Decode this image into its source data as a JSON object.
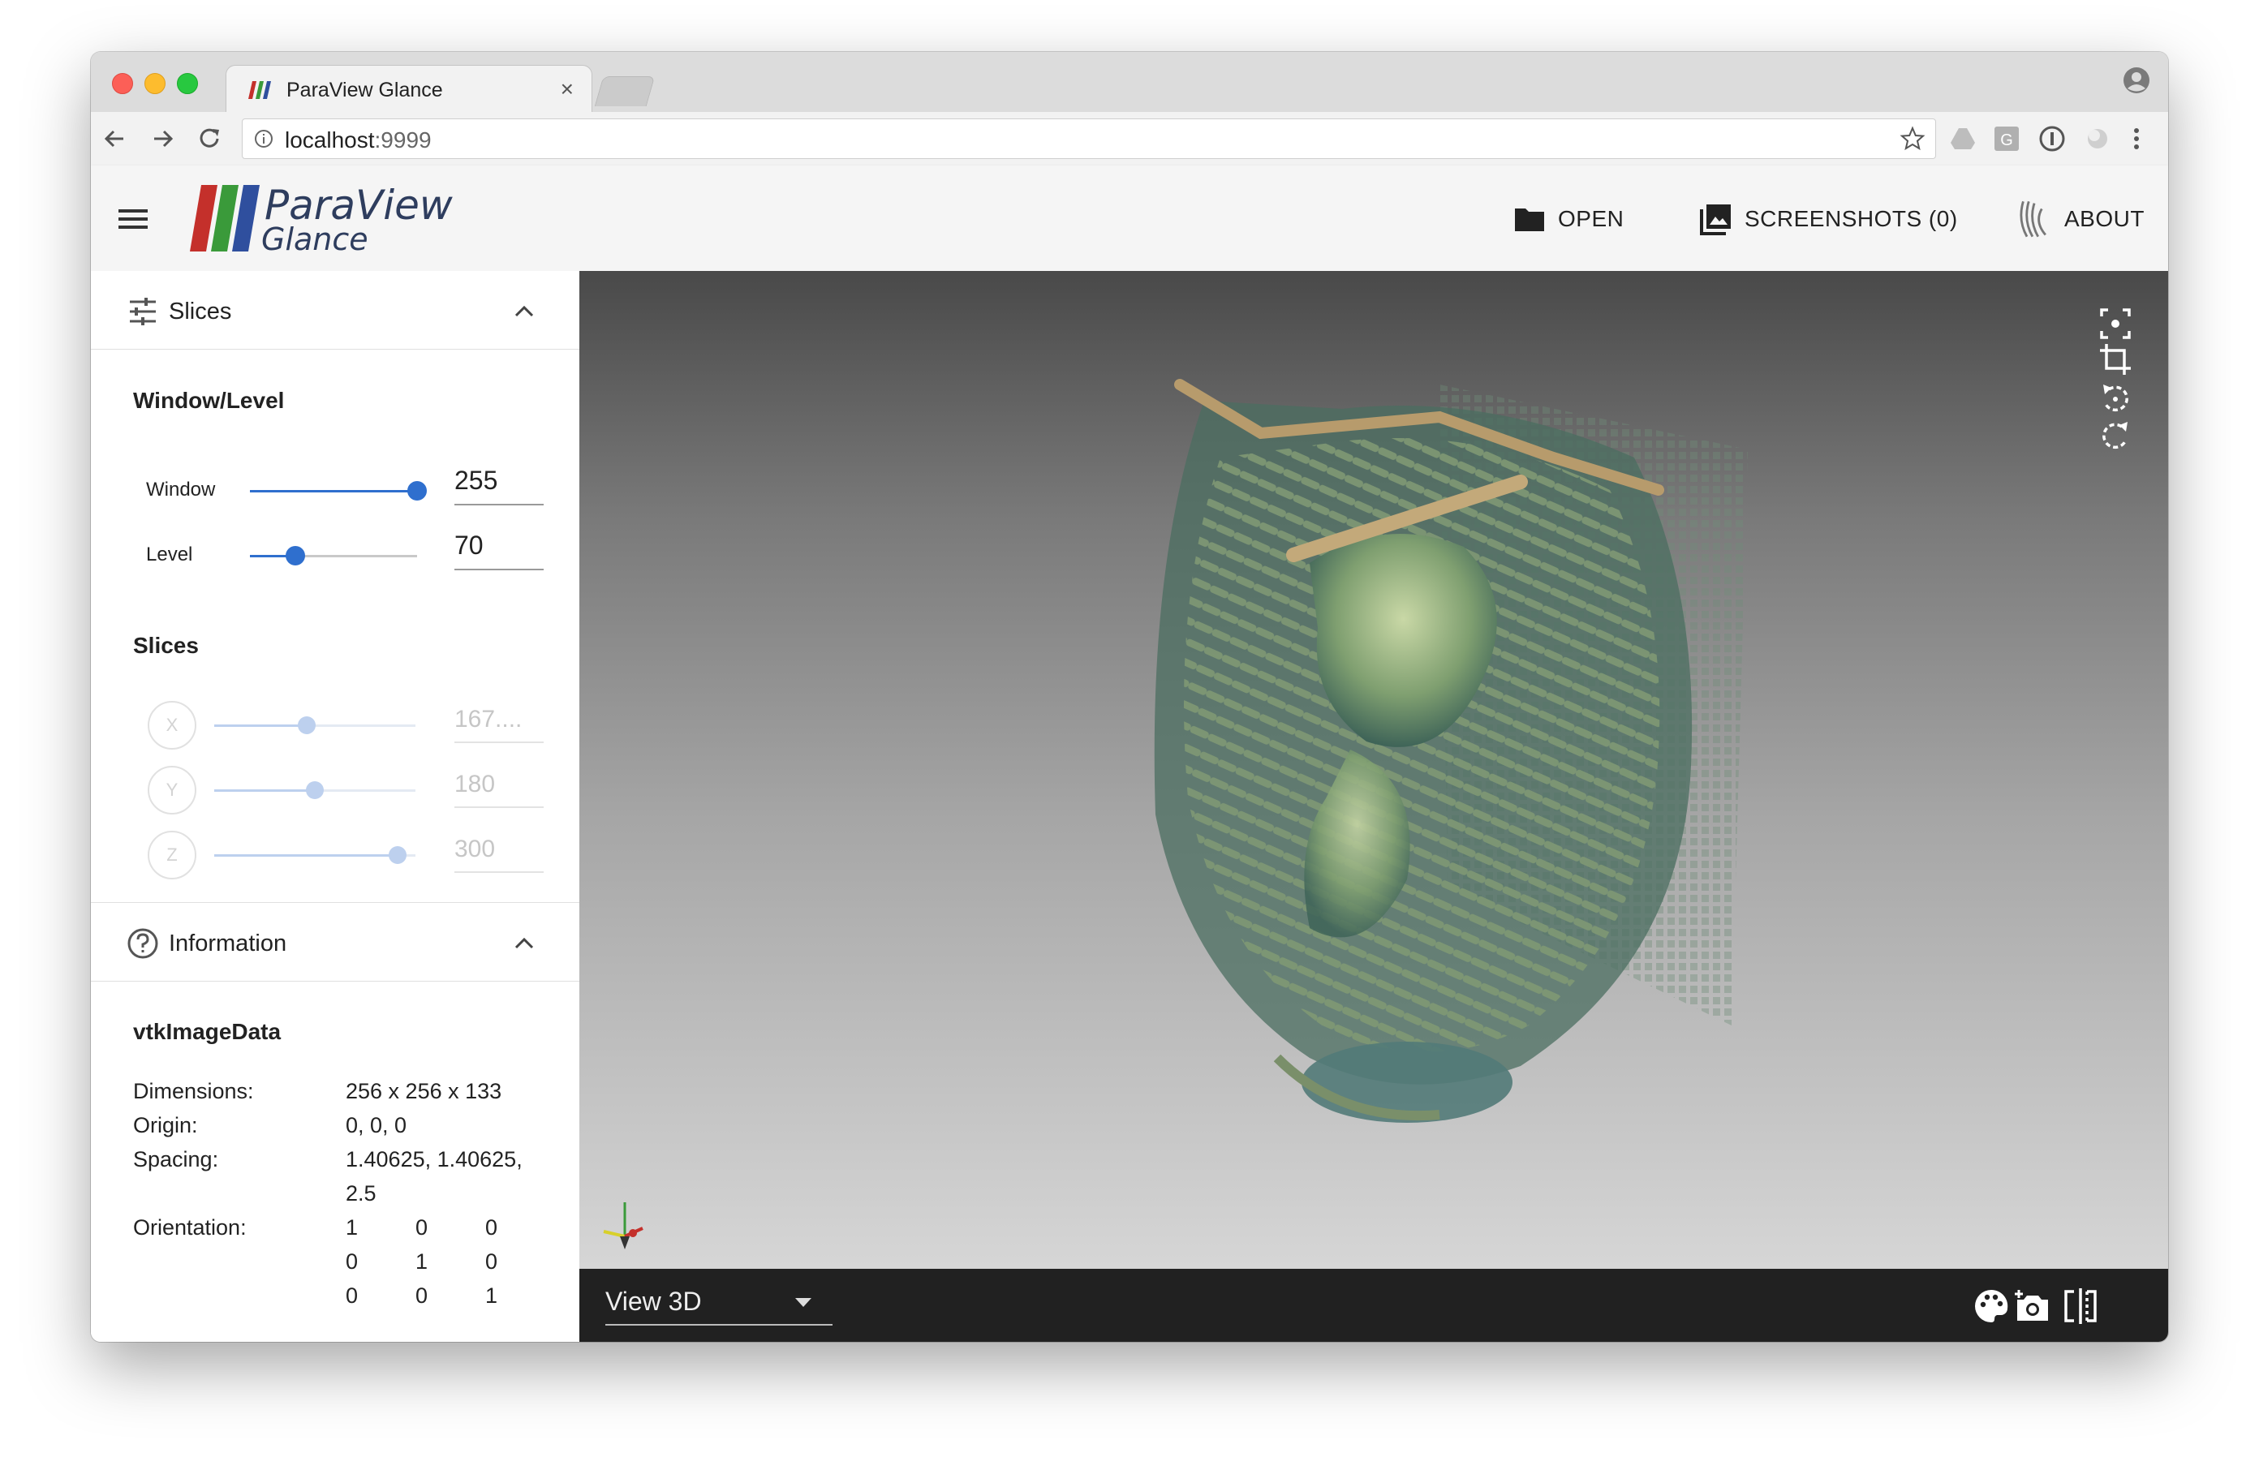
{
  "browser": {
    "tab_title": "ParaView Glance",
    "tab_close": "×",
    "url_host": "localhost",
    "url_port": ":9999"
  },
  "appbar": {
    "logo_top": "ParaView",
    "logo_bottom": "Glance",
    "open_label": "OPEN",
    "screenshots_label": "SCREENSHOTS (0)",
    "about_label": "ABOUT"
  },
  "slices_panel": {
    "title": "Slices",
    "window_level": {
      "heading": "Window/Level",
      "window_label": "Window",
      "window_value": "255",
      "window_fraction": 1.0,
      "level_label": "Level",
      "level_value": "70",
      "level_fraction": 0.27
    },
    "slices": {
      "heading": "Slices",
      "items": [
        {
          "axis": "X",
          "value": "167....",
          "fraction": 0.46
        },
        {
          "axis": "Y",
          "value": "180",
          "fraction": 0.5
        },
        {
          "axis": "Z",
          "value": "300",
          "fraction": 0.91
        }
      ]
    }
  },
  "information_panel": {
    "title": "Information",
    "data_type": "vtkImageData",
    "dimensions_label": "Dimensions:",
    "dimensions_value": "256 x 256 x 133",
    "origin_label": "Origin:",
    "origin_value": "0, 0, 0",
    "spacing_label": "Spacing:",
    "spacing_value_line1": "1.40625, 1.40625,",
    "spacing_value_line2": "2.5",
    "orientation_label": "Orientation:",
    "orientation_rows": [
      [
        "1",
        "0",
        "0"
      ],
      [
        "0",
        "1",
        "0"
      ],
      [
        "0",
        "0",
        "1"
      ]
    ]
  },
  "viewport": {
    "view_selector": "View 3D",
    "background_top": "#494949",
    "background_bottom": "#d6d6d6"
  },
  "colors": {
    "accent": "#2f6fce",
    "bottom_bar": "#212121",
    "logo_red": "#c4302b",
    "logo_green": "#3a9a3a",
    "logo_blue": "#2f4f9e"
  }
}
